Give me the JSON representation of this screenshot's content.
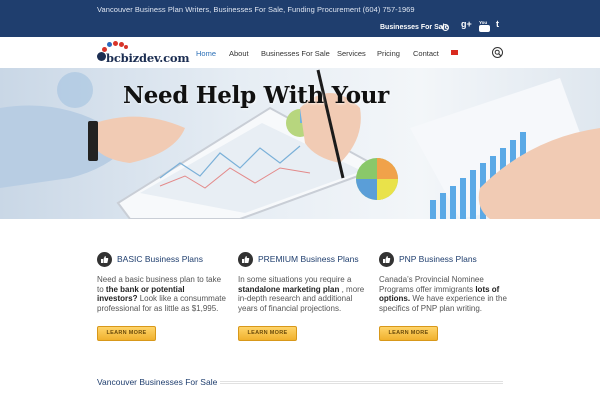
{
  "topbar": {
    "tagline": "Vancouver Business Plan Writers, Businesses For Sale, Funding Procurement (604) 757-1969",
    "businesses_for_sale": "Businesses For Sale",
    "social": {
      "gplus": "g+",
      "youtube": "You",
      "twitter": "t"
    }
  },
  "logo": {
    "text": "bcbizdev.com"
  },
  "nav": {
    "items": [
      "Home",
      "About",
      "Businesses For Sale",
      "Services",
      "Pricing",
      "Contact"
    ]
  },
  "hero": {
    "headline": "Need Help With Your"
  },
  "columns": [
    {
      "title": "BASIC Business Plans",
      "body": [
        {
          "t": "Need a basic business plan to take to ",
          "b": false
        },
        {
          "t": "the bank or potential investors?",
          "b": true
        },
        {
          "t": " Look like a consummate professional for as little as $1,995.",
          "b": false
        }
      ],
      "button": "LEARN MORE"
    },
    {
      "title": "PREMIUM Business Plans",
      "body": [
        {
          "t": "In some situations you require a ",
          "b": false
        },
        {
          "t": "standalone marketing plan",
          "b": true
        },
        {
          "t": " , more in-depth research and additional years of financial projections.",
          "b": false
        }
      ],
      "button": "LEARN MORE"
    },
    {
      "title": "PNP Business Plans",
      "body": [
        {
          "t": "Canada’s Provincial Nominee Programs offer immigrants ",
          "b": false
        },
        {
          "t": "lots of options.",
          "b": true
        },
        {
          "t": " We have experience in the specifics of PNP plan writing.",
          "b": false
        }
      ],
      "button": "LEARN MORE"
    }
  ],
  "section": {
    "heading": "Vancouver Businesses For Sale"
  },
  "colors": {
    "topbar": "#1f3e6e",
    "accent": "#2b6fb7",
    "button": "#f0b12e"
  }
}
